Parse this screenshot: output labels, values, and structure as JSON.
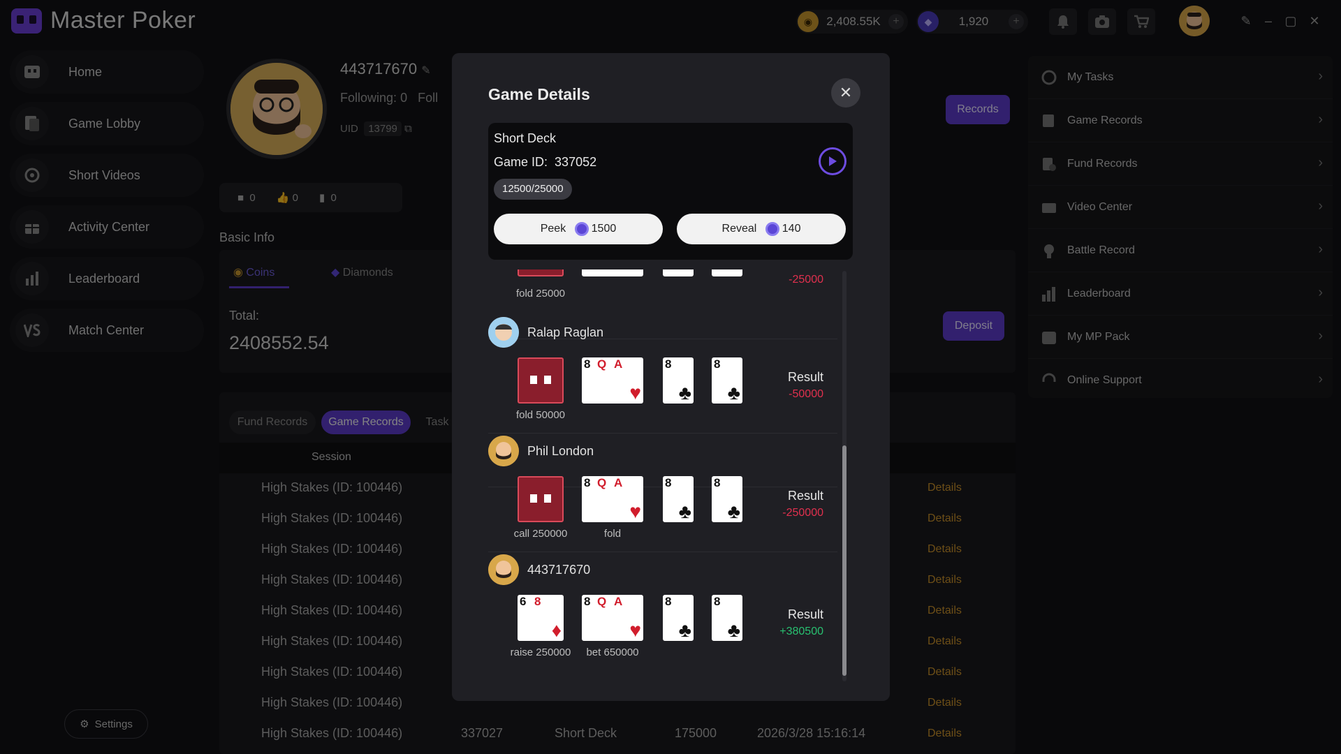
{
  "app": {
    "name": "Master Poker"
  },
  "topbar": {
    "coins": "2,408.55K",
    "diamonds": "1,920",
    "plus": "+"
  },
  "nav": [
    {
      "label": "Home",
      "icon": "home-icon"
    },
    {
      "label": "Game Lobby",
      "icon": "game-lobby-icon"
    },
    {
      "label": "Short Videos",
      "icon": "short-videos-icon"
    },
    {
      "label": "Activity Center",
      "icon": "gift-icon"
    },
    {
      "label": "Leaderboard",
      "icon": "leaderboard-icon"
    },
    {
      "label": "Match Center",
      "icon": "vs-icon"
    }
  ],
  "settings_label": "Settings",
  "profile": {
    "name": "443717670",
    "following_label": "Following:",
    "following": "0",
    "followers_label": "Foll",
    "uid_label": "UID",
    "uid": "13799",
    "videos": "0",
    "likes": "0",
    "saves": "0"
  },
  "basic_info": "Basic Info",
  "wallet": {
    "tab_coins": "Coins",
    "tab_diamonds": "Diamonds",
    "total_label": "Total:",
    "total": "2408552.54",
    "deposit": "Deposit",
    "records": "Records"
  },
  "records": {
    "tabs": [
      "Fund Records",
      "Game Records",
      "Task"
    ],
    "session_header": "Session",
    "rows": [
      {
        "session": "High Stakes (ID: 100446)",
        "details": "Details"
      },
      {
        "session": "High Stakes (ID: 100446)",
        "details": "Details"
      },
      {
        "session": "High Stakes (ID: 100446)",
        "details": "Details"
      },
      {
        "session": "High Stakes (ID: 100446)",
        "details": "Details"
      },
      {
        "session": "High Stakes (ID: 100446)",
        "details": "Details"
      },
      {
        "session": "High Stakes (ID: 100446)",
        "details": "Details"
      },
      {
        "session": "High Stakes (ID: 100446)",
        "details": "Details"
      },
      {
        "session": "High Stakes (ID: 100446)",
        "details": "Details"
      },
      {
        "session": "High Stakes (ID: 100446)",
        "game_id": "337027",
        "type": "Short Deck",
        "amount": "175000",
        "time": "2026/3/28 15:16:14",
        "details": "Details"
      }
    ]
  },
  "right_menu": [
    {
      "label": "My Tasks",
      "icon": "tasks-icon"
    },
    {
      "label": "Game Records",
      "icon": "game-records-icon"
    },
    {
      "label": "Fund Records",
      "icon": "fund-records-icon"
    },
    {
      "label": "Video Center",
      "icon": "video-center-icon"
    },
    {
      "label": "Battle Record",
      "icon": "battle-record-icon"
    },
    {
      "label": "Leaderboard",
      "icon": "leaderboard-icon"
    },
    {
      "label": "My MP Pack",
      "icon": "mp-pack-icon"
    },
    {
      "label": "Online Support",
      "icon": "support-icon"
    }
  ],
  "modal": {
    "title": "Game Details",
    "game_type": "Short Deck",
    "game_id_label": "Game ID:",
    "game_id": "337052",
    "blinds": "12500/25000",
    "peek_label": "Peek",
    "peek_cost": "1500",
    "reveal_label": "Reveal",
    "reveal_cost": "140",
    "partial": {
      "action": "fold 25000",
      "result": "-25000"
    },
    "players": [
      {
        "name": "Ralap Raglan",
        "action1": "fold 50000",
        "action2": "",
        "result_label": "Result",
        "result": "-50000"
      },
      {
        "name": "Phil London",
        "action1": "call 250000",
        "action2": "fold",
        "result_label": "Result",
        "result": "-250000"
      },
      {
        "name": "443717670",
        "action1": "raise 250000",
        "action2": "bet 650000",
        "result_label": "Result",
        "result": "+380500"
      }
    ],
    "board_cards": [
      "8",
      "Q",
      "A",
      "8",
      "8"
    ],
    "hero_cards": [
      "6",
      "8"
    ]
  }
}
